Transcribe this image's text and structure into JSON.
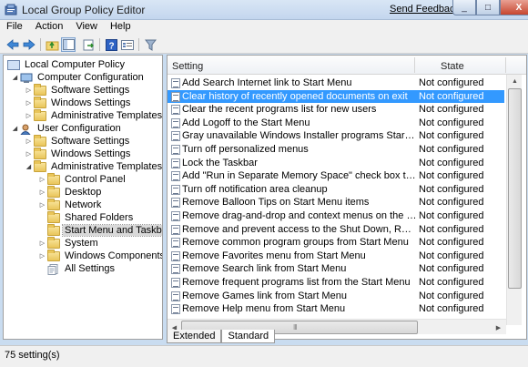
{
  "window": {
    "title": "Local Group Policy Editor",
    "feedback_link": "Send Feedback",
    "minimize_glyph": "_",
    "maximize_glyph": "□",
    "close_glyph": "X"
  },
  "menu": {
    "items": [
      "File",
      "Action",
      "View",
      "Help"
    ]
  },
  "toolbar": {
    "icons": [
      "back-arrow-icon",
      "forward-arrow-icon",
      "up-folder-icon",
      "show-hide-tree-icon",
      "export-list-icon",
      "help-icon",
      "properties-icon",
      "filter-icon"
    ]
  },
  "tree": {
    "root": "Local Computer Policy",
    "computer_configuration": "Computer Configuration",
    "cc_software_settings": "Software Settings",
    "cc_windows_settings": "Windows Settings",
    "cc_administrative_templates": "Administrative Templates",
    "user_configuration": "User Configuration",
    "uc_software_settings": "Software Settings",
    "uc_windows_settings": "Windows Settings",
    "uc_administrative_templates": "Administrative Templates",
    "control_panel": "Control Panel",
    "desktop": "Desktop",
    "network": "Network",
    "shared_folders": "Shared Folders",
    "start_menu_taskbar": "Start Menu and Taskbar",
    "system": "System",
    "windows_components": "Windows Components",
    "all_settings": "All Settings"
  },
  "table": {
    "columns": {
      "setting": "Setting",
      "state": "State"
    },
    "rows": [
      {
        "setting": "Add Search Internet link to Start Menu",
        "state": "Not configured"
      },
      {
        "setting": "Clear history of recently opened documents on exit",
        "state": "Not configured"
      },
      {
        "setting": "Clear the recent programs list for new users",
        "state": "Not configured"
      },
      {
        "setting": "Add Logoff to the Start Menu",
        "state": "Not configured"
      },
      {
        "setting": "Gray unavailable Windows Installer programs Start Menu sh...",
        "state": "Not configured"
      },
      {
        "setting": "Turn off personalized menus",
        "state": "Not configured"
      },
      {
        "setting": "Lock the Taskbar",
        "state": "Not configured"
      },
      {
        "setting": "Add \"Run in Separate Memory Space\" check box to Run dial...",
        "state": "Not configured"
      },
      {
        "setting": "Turn off notification area cleanup",
        "state": "Not configured"
      },
      {
        "setting": "Remove Balloon Tips on Start Menu items",
        "state": "Not configured"
      },
      {
        "setting": "Remove drag-and-drop and context menus on the Start Me...",
        "state": "Not configured"
      },
      {
        "setting": "Remove and prevent access to the Shut Down, Restart, Sleep...",
        "state": "Not configured"
      },
      {
        "setting": "Remove common program groups from Start Menu",
        "state": "Not configured"
      },
      {
        "setting": "Remove Favorites menu from Start Menu",
        "state": "Not configured"
      },
      {
        "setting": "Remove Search link from Start Menu",
        "state": "Not configured"
      },
      {
        "setting": "Remove frequent programs list from the Start Menu",
        "state": "Not configured"
      },
      {
        "setting": "Remove Games link from Start Menu",
        "state": "Not configured"
      },
      {
        "setting": "Remove Help menu from Start Menu",
        "state": "Not configured"
      }
    ],
    "selected_row": "Clear history of recently opened documents on exit",
    "scroll_grip": "III"
  },
  "tabs": [
    "Extended",
    "Standard"
  ],
  "active_tab": "Standard",
  "status": {
    "count": "75 setting(s)"
  },
  "colors": {
    "selection": "#3399ff",
    "title_bar": "#c9dcf0"
  }
}
